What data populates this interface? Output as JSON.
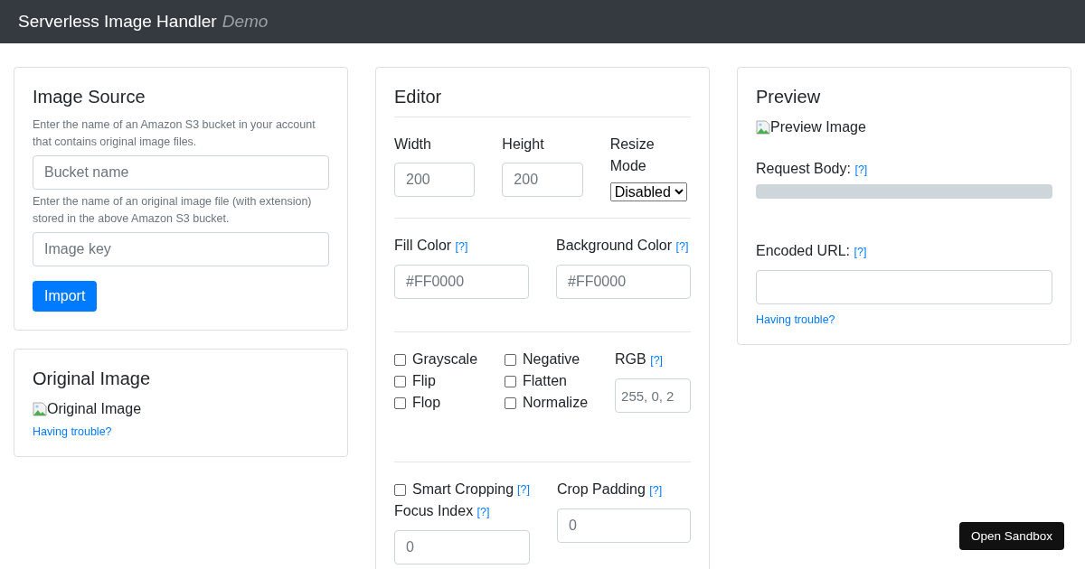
{
  "header": {
    "title": "Serverless Image Handler",
    "subtitle": "Demo"
  },
  "image_source": {
    "title": "Image Source",
    "bucket_help": "Enter the name of an Amazon S3 bucket in your account that contains original image files.",
    "bucket_placeholder": "Bucket name",
    "key_help": "Enter the name of an original image file (with extension) stored in the above Amazon S3 bucket.",
    "key_placeholder": "Image key",
    "import_button": "Import"
  },
  "original_image": {
    "title": "Original Image",
    "image_alt": "Original Image",
    "help_link": "Having trouble?"
  },
  "editor": {
    "title": "Editor",
    "width": {
      "label": "Width",
      "placeholder": "200"
    },
    "height": {
      "label": "Height",
      "placeholder": "200"
    },
    "resize_mode": {
      "label": "Resize Mode",
      "value": "Disabled"
    },
    "fill_color": {
      "label": "Fill Color",
      "help": "[?]",
      "placeholder": "#FF0000"
    },
    "background_color": {
      "label": "Background Color",
      "help": "[?]",
      "placeholder": "#FF0000"
    },
    "filter_columns": [
      {
        "items": [
          {
            "label": "Grayscale",
            "checked": false
          },
          {
            "label": "Flip",
            "checked": false
          },
          {
            "label": "Flop",
            "checked": false
          }
        ]
      },
      {
        "items": [
          {
            "label": "Negative",
            "checked": false
          },
          {
            "label": "Flatten",
            "checked": false
          },
          {
            "label": "Normalize",
            "checked": false
          }
        ]
      }
    ],
    "rgb": {
      "label": "RGB",
      "help": "[?]",
      "placeholder": "255, 0, 2"
    },
    "smart_cropping": {
      "label": "Smart Cropping",
      "help": "[?]",
      "checked": false
    },
    "focus_index": {
      "label": "Focus Index",
      "help": "[?]",
      "placeholder": "0"
    },
    "crop_padding": {
      "label": "Crop Padding",
      "help": "[?]",
      "placeholder": "0"
    }
  },
  "preview": {
    "title": "Preview",
    "image_alt": "Preview Image",
    "request_body": {
      "label": "Request Body:",
      "help": "[?]"
    },
    "encoded_url": {
      "label": "Encoded URL:",
      "help": "[?]"
    },
    "help_link": "Having trouble?"
  },
  "sandbox_button": "Open Sandbox"
}
